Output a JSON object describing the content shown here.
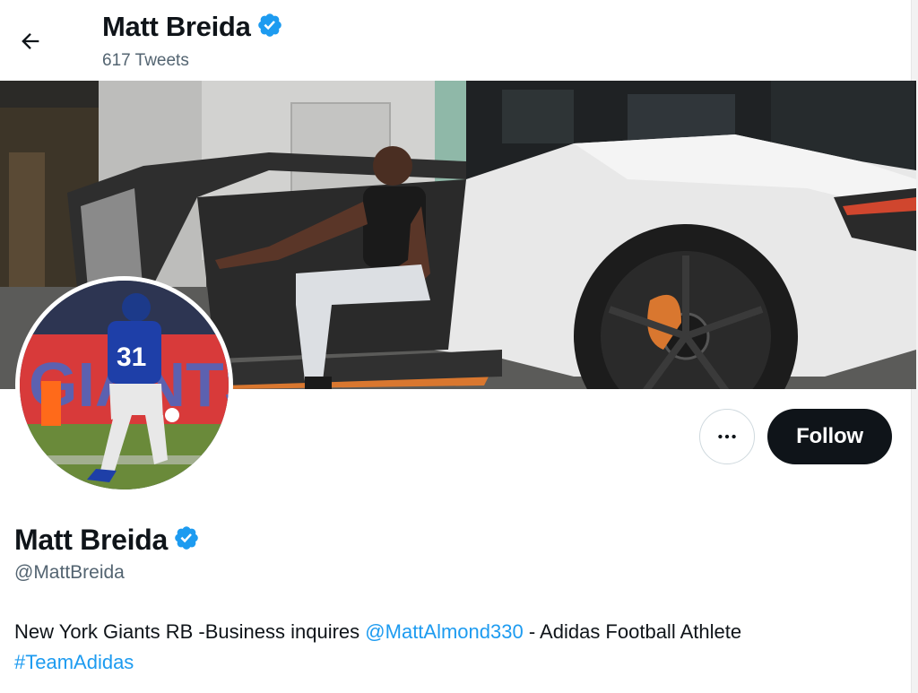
{
  "header": {
    "back_label": "Back",
    "name": "Matt Breida",
    "tweets_count": "617 Tweets"
  },
  "profile": {
    "display_name": "Matt Breida",
    "handle": "@MattBreida",
    "follow_label": "Follow",
    "more_label": "•••",
    "bio": {
      "text_1": "New York Giants RB -Business inquires ",
      "mention": "@MattAlmond330",
      "text_2": " - Adidas Football Athlete ",
      "hashtag": "#TeamAdidas"
    }
  },
  "avatar_jersey_number": "31",
  "colors": {
    "verified": "#1d9bf0",
    "link": "#1d9bf0",
    "follow_bg": "#0f1419",
    "secondary_text": "#536471"
  },
  "icons": {
    "back": "arrow-left-icon",
    "verified": "verified-badge-icon",
    "more": "more-horizontal-icon"
  }
}
